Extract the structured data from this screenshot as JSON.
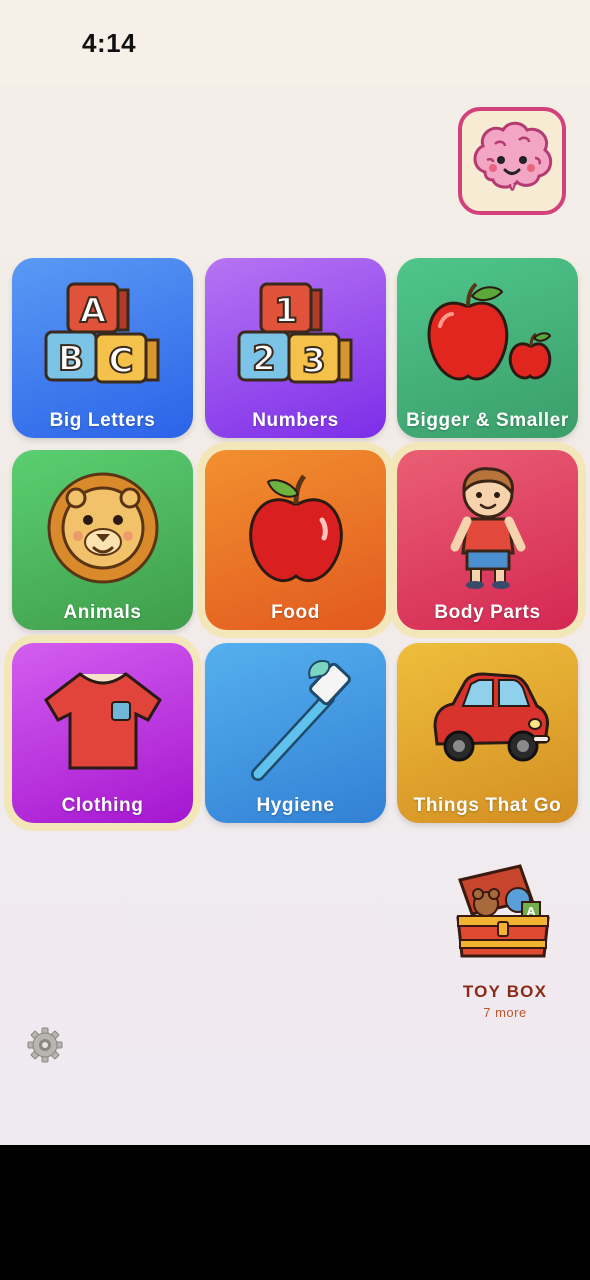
{
  "status_bar": {
    "time": "4:14"
  },
  "header": {
    "brain_icon": "smiling-brain-icon"
  },
  "categories": [
    {
      "label": "Big Letters",
      "icon": "abc-blocks-icon",
      "color": "#2b63e8"
    },
    {
      "label": "Numbers",
      "icon": "123-blocks-icon",
      "color": "#7c2ee8"
    },
    {
      "label": "Bigger & Smaller",
      "icon": "two-apples-icon",
      "color": "#3b9e6a"
    },
    {
      "label": "Animals",
      "icon": "lion-icon",
      "color": "#3f9d4a"
    },
    {
      "label": "Food",
      "icon": "apple-icon",
      "color": "#e2591f"
    },
    {
      "label": "Body Parts",
      "icon": "boy-icon",
      "color": "#d42752"
    },
    {
      "label": "Clothing",
      "icon": "tshirt-icon",
      "color": "#a516cf"
    },
    {
      "label": "Hygiene",
      "icon": "toothbrush-icon",
      "color": "#3280d4"
    },
    {
      "label": "Things That Go",
      "icon": "car-icon",
      "color": "#d38e22"
    }
  ],
  "toy_box": {
    "title": "TOY BOX",
    "subtitle": "7 more",
    "icon": "toy-chest-icon"
  },
  "settings": {
    "icon": "gear-icon"
  },
  "colors": {
    "highlight": "#f3e6b8",
    "toybox_title": "#8a2b18",
    "brain_border": "#d2417c"
  }
}
